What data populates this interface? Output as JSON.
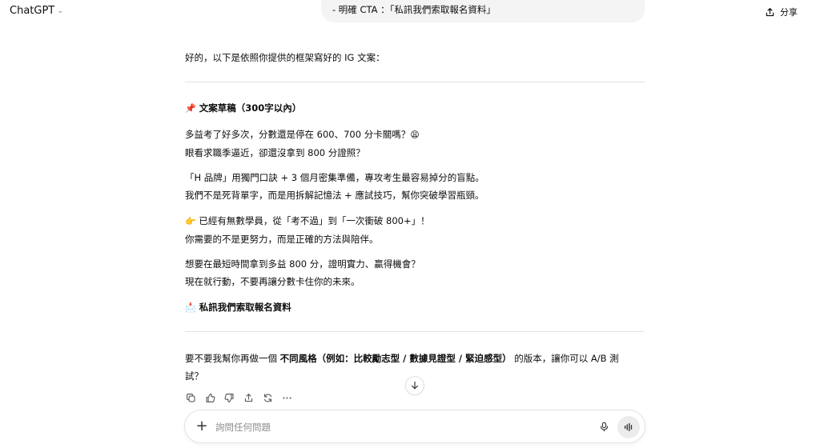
{
  "header": {
    "app_title": "ChatGPT",
    "share_label": "分享"
  },
  "user_message": {
    "visible_line": "- 明確 CTA ：「私訊我們索取報名資料」"
  },
  "assistant": {
    "intro": "好的，以下是依照你提供的框架寫好的 IG 文案：",
    "draft_heading_emoji": "📌",
    "draft_heading": "文案草稿（300字以內）",
    "para1_line1": "多益考了好多次，分數還是停在 600、700 分卡關嗎？",
    "para1_emoji": "😩",
    "para1_line2": "眼看求職季逼近，卻還沒拿到 800 分證照？",
    "para2_line1": "「H 品牌」用獨門口訣 + 3 個月密集準備，專攻考生最容易掉分的盲點。",
    "para2_line2": "我們不是死背單字，而是用拆解記憶法 + 應試技巧，幫你突破學習瓶頸。",
    "para3_emoji": "👉",
    "para3_line1": "已經有無數學員，從「考不過」到「一次衝破 800+」！",
    "para3_line2": "你需要的不是更努力，而是正確的方法與陪伴。",
    "para4_line1": "想要在最短時間拿到多益 800 分，證明實力、贏得機會？",
    "para4_line2": "現在就行動，不要再讓分數卡住你的未來。",
    "cta_emoji": "📩",
    "cta": "私訊我們索取報名資料",
    "followup_pre": "要不要我幫你再做一個 ",
    "followup_bold": "不同風格（例如：比較勵志型 / 數據見證型 / 緊迫感型）",
    "followup_post": " 的版本，讓你可以 A/B 測",
    "followup_line2": "試？"
  },
  "composer": {
    "placeholder": "詢問任何問題"
  },
  "icons": {
    "copy": "copy-icon",
    "thumbs_up": "thumbs-up-icon",
    "thumbs_down": "thumbs-down-icon",
    "share": "share-icon",
    "regenerate": "regenerate-icon",
    "more": "more-icon",
    "scroll_down": "arrow-down-icon",
    "plus": "plus-icon",
    "mic": "mic-icon",
    "voice": "voice-mode-icon"
  }
}
